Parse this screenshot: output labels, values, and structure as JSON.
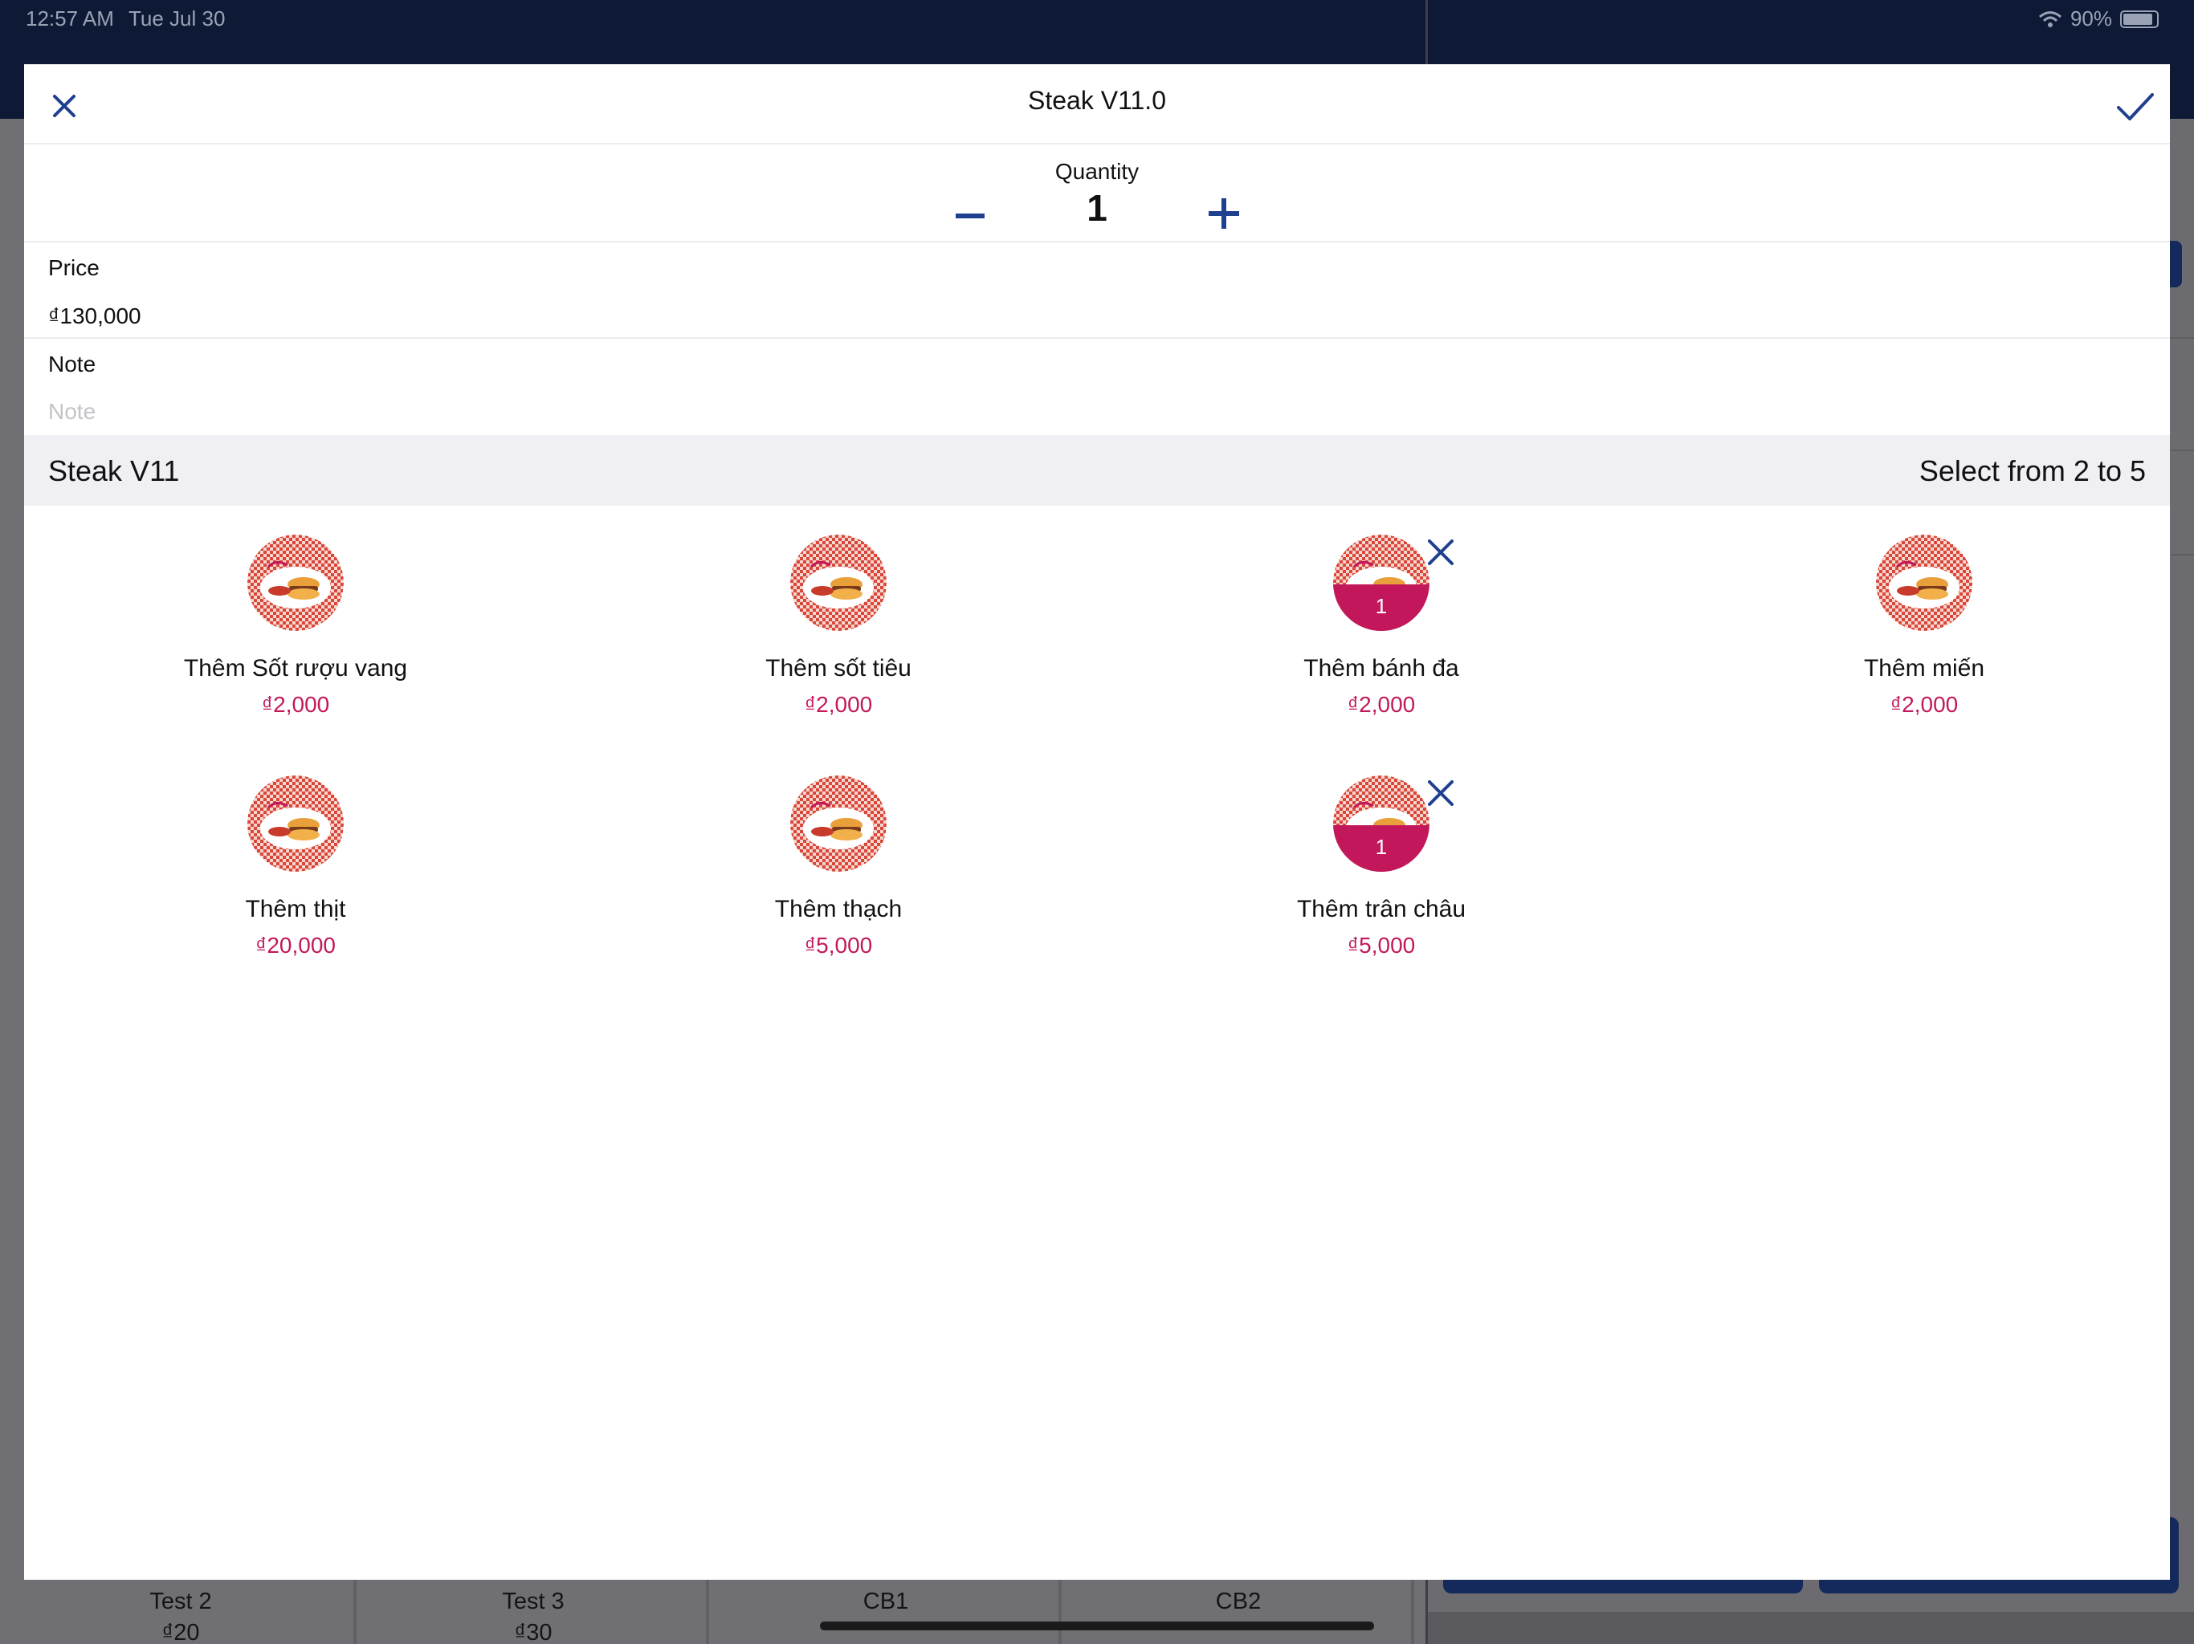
{
  "status_bar": {
    "time": "12:57 AM",
    "date": "Tue Jul 30",
    "battery": "90%"
  },
  "background_tiles": [
    {
      "name": "Test 2",
      "price": "₫20"
    },
    {
      "name": "Test 3",
      "price": "₫30"
    },
    {
      "name": "CB1",
      "price": ""
    },
    {
      "name": "CB2",
      "price": ""
    }
  ],
  "modal": {
    "title": "Steak V11.0",
    "quantity": {
      "label": "Quantity",
      "value": "1"
    },
    "price": {
      "label": "Price",
      "value": "₫130,000"
    },
    "note": {
      "label": "Note",
      "placeholder": "Note",
      "value": ""
    },
    "group": {
      "title": "Steak V11",
      "rule": "Select from 2 to 5"
    },
    "options": [
      {
        "name": "Thêm Sốt rượu vang",
        "price": "₫2,000",
        "selected": false,
        "count": ""
      },
      {
        "name": "Thêm sốt tiêu",
        "price": "₫2,000",
        "selected": false,
        "count": ""
      },
      {
        "name": "Thêm bánh đa",
        "price": "₫2,000",
        "selected": true,
        "count": "1"
      },
      {
        "name": "Thêm miến",
        "price": "₫2,000",
        "selected": false,
        "count": ""
      },
      {
        "name": "Thêm thịt",
        "price": "₫20,000",
        "selected": false,
        "count": ""
      },
      {
        "name": "Thêm thạch",
        "price": "₫5,000",
        "selected": false,
        "count": ""
      },
      {
        "name": "Thêm trân châu",
        "price": "₫5,000",
        "selected": true,
        "count": "1"
      }
    ]
  },
  "icons": {
    "close": "close-icon",
    "confirm": "checkmark-icon",
    "minus": "minus-icon",
    "plus": "plus-icon",
    "remove": "remove-x-icon",
    "item_image": "food-plate-thumbnail"
  },
  "colors": {
    "accent": "#1f3f8f",
    "selected": "#c2185b",
    "price": "#c2185b",
    "header_bg": "#0e1a35",
    "group_bg": "#efeff4"
  }
}
